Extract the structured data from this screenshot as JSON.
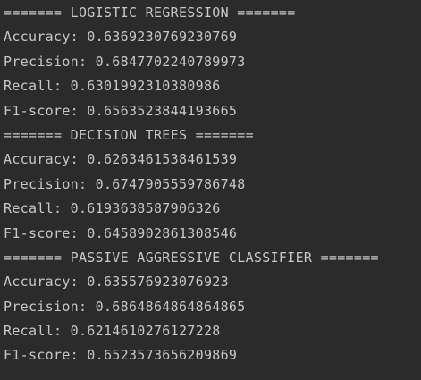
{
  "console": {
    "text_color": "#c8c8c8",
    "background": "#2b2b2b",
    "lines": [
      "======= LOGISTIC REGRESSION =======",
      "Accuracy: 0.6369230769230769",
      "Precision: 0.6847702240789973",
      "Recall: 0.6301992310380986",
      "F1-score: 0.6563523844193665",
      "======= DECISION TREES =======",
      "Accuracy: 0.6263461538461539",
      "Precision: 0.6747905559786748",
      "Recall: 0.6193638587906326",
      "F1-score: 0.6458902861308546",
      "======= PASSIVE AGGRESSIVE CLASSIFIER =======",
      "Accuracy: 0.635576923076923",
      "Precision: 0.6864864864864865",
      "Recall: 0.6214610276127228",
      "F1-score: 0.6523573656209869"
    ]
  }
}
